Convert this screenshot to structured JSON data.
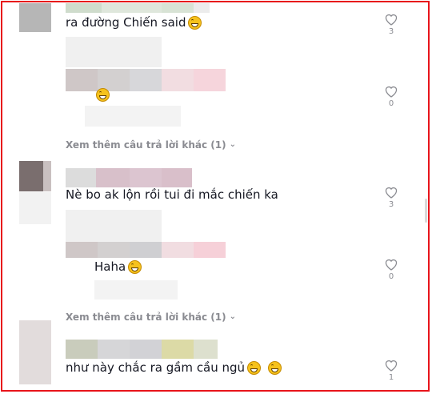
{
  "comments": [
    {
      "text": "ra đường Chiến said",
      "likes": "3"
    },
    {
      "text": "",
      "likes": "0"
    },
    {
      "text": "Nè bo ak lộn rồi tui đi mắc chiến ka",
      "likes": "3"
    },
    {
      "text": "Haha",
      "likes": "0"
    },
    {
      "text": "như này chắc ra gầm cầu ngủ",
      "likes": "1"
    }
  ],
  "view_more_label": "Xem thêm câu trả lời khác (1)",
  "icons": {
    "like": "heart-outline-icon",
    "chevron": "chevron-down-icon",
    "emoji": "grinning-emoji-icon"
  },
  "colors": {
    "border": "#e8141b",
    "text": "#161823",
    "muted": "#8a8b91"
  }
}
